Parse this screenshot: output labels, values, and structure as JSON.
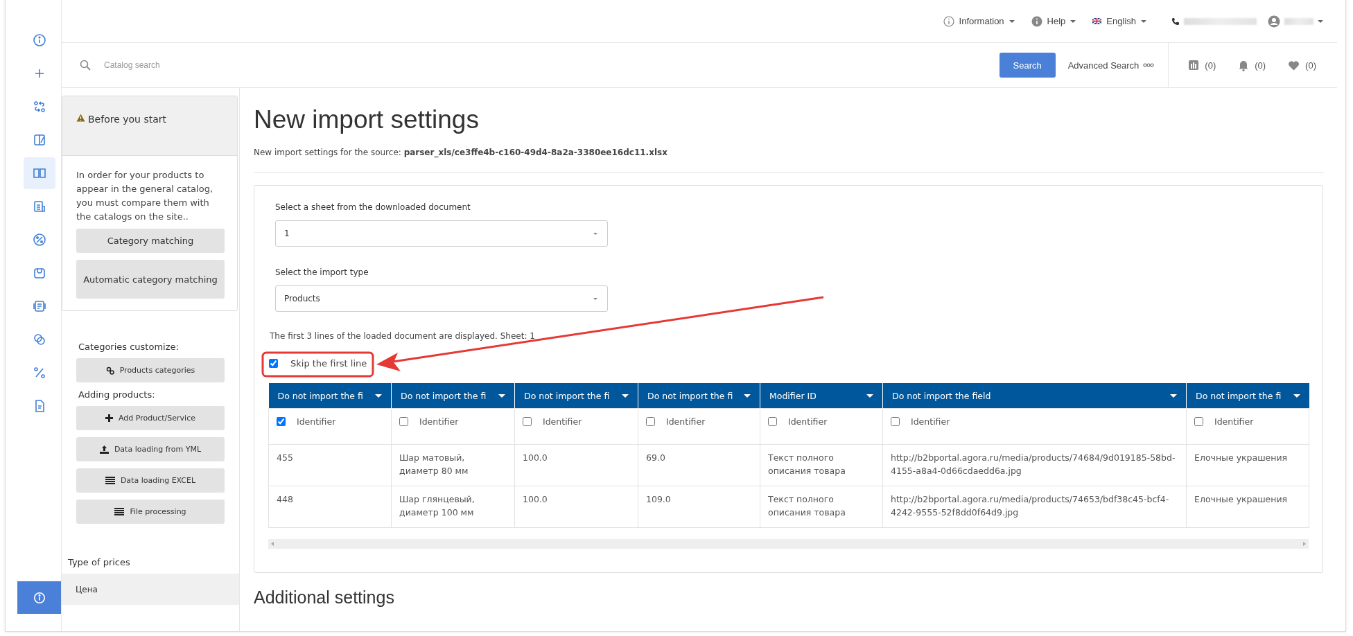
{
  "rail": {
    "items": [
      {
        "selected": false
      },
      {
        "selected": false
      },
      {
        "selected": false
      },
      {
        "selected": false
      },
      {
        "selected": true
      },
      {
        "selected": false
      },
      {
        "selected": false
      },
      {
        "selected": false
      },
      {
        "selected": false
      },
      {
        "selected": false
      },
      {
        "selected": false
      },
      {
        "selected": false
      }
    ]
  },
  "top_bar": {
    "links": [
      {
        "label": "Information"
      },
      {
        "label": "Help"
      },
      {
        "label": "English"
      }
    ]
  },
  "search": {
    "placeholder": "Catalog search",
    "button": "Search",
    "advanced": "Advanced Search"
  },
  "counters": [
    "(0)",
    "(0)",
    "(0)"
  ],
  "sidebar": {
    "notice": {
      "title": "Before you start",
      "text": "In order for your products to appear in the general catalog, you must compare them with the catalogs on the site..",
      "buttons": [
        "Category matching",
        "Automatic category matching"
      ]
    },
    "sections": [
      {
        "heading": "Categories customize:",
        "buttons": [
          "Products categories"
        ]
      },
      {
        "heading": "Adding products:",
        "buttons": [
          "Add Product/Service",
          "Data loading from YML",
          "Data loading EXCEL",
          "File processing"
        ]
      }
    ],
    "prices": {
      "heading": "Type of prices",
      "items": [
        {
          "label": "Цена",
          "selected": true
        }
      ]
    }
  },
  "page": {
    "title": "New import settings",
    "subtitle": "New import settings for the source: **parser_xls/ce3ffe4b-c160-49d4-8a2a-3380ee16dc11.xlsx**",
    "sheet_select": {
      "label": "Select a sheet from the downloaded document",
      "value": "1"
    },
    "type_select": {
      "label": "Select the import type",
      "value": "Products"
    },
    "info": "The first 3 lines of the loaded document are displayed. Sheet: 1",
    "skip_first_line": {
      "label": "Skip the first line",
      "checked": true
    },
    "table": {
      "columns": [
        "Do not import the fi",
        "Do not import the fi",
        "Do not import the fi",
        "Do not import the fi",
        "Modifier ID",
        "Do not import the field",
        "Do not import the fi"
      ],
      "identifier_row": [
        {
          "label": "Identifier",
          "checked": true
        },
        {
          "label": "Identifier",
          "checked": false
        },
        {
          "label": "Identifier",
          "checked": false
        },
        {
          "label": "Identifier",
          "checked": false
        },
        {
          "label": "Identifier",
          "checked": false
        },
        {
          "label": "Identifier",
          "checked": false
        },
        {
          "label": "Identifier",
          "checked": false
        }
      ],
      "rows": [
        [
          "455",
          "Шар матовый, диаметр 80 мм",
          "100.0",
          "69.0",
          "Текст полного описания товара",
          "http://b2bportal.agora.ru/media/products/74684/9d019185-58bd-4155-a8a4-0d66cdaedd6a.jpg",
          "Елочные украшения"
        ],
        [
          "448",
          "Шар глянцевый, диаметр 100 мм",
          "100.0",
          "109.0",
          "Текст полного описания товара",
          "http://b2bportal.agora.ru/media/products/74653/bdf38c45-bcf4-4242-9555-52f8dd0f64d9.jpg",
          "Елочные украшения"
        ]
      ]
    },
    "additional_title": "Additional settings"
  }
}
